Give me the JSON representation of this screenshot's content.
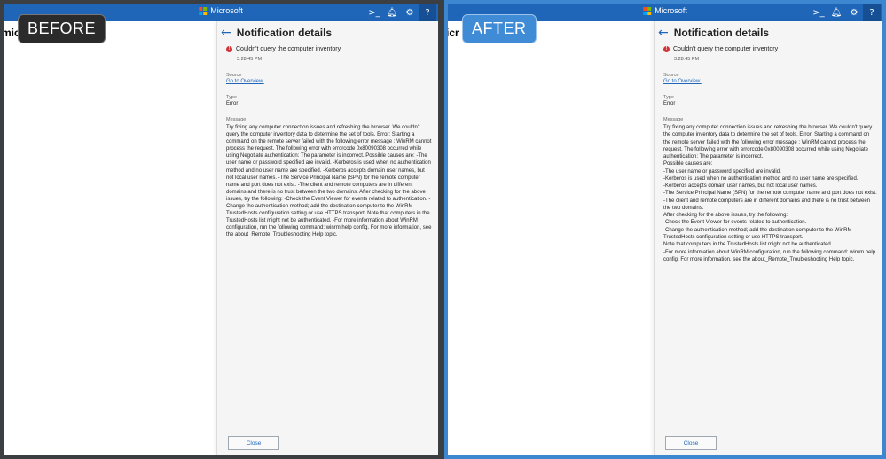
{
  "before": {
    "badge": "BEFORE",
    "background_text": "mic",
    "topbar": {
      "brand": "Microsoft",
      "icons": [
        "terminal-icon",
        "bell-icon",
        "gear-icon",
        "help-icon"
      ]
    },
    "pane": {
      "title": "Notification details",
      "error_title": "Couldn't query the computer inventory",
      "time": "3:28:45 PM",
      "source_label": "Source",
      "source_link": "Go to Overview.",
      "type_label": "Type",
      "type_value": "Error",
      "message_label": "Message",
      "message": "Try fixing any computer connection issues and refreshing the browser. We couldn't query the computer inventory data to determine the set of tools. Error: Starting a command on the remote server failed with the following error message : WinRM cannot process the request. The following error with errorcode 0x80090308 occurred while using Negotiate authentication: The parameter is incorrect. Possible causes are: -The user name or password specified are invalid. -Kerberos is used when no authentication method and no user name are specified. -Kerberos accepts domain user names, but not local user names. -The Service Principal Name (SPN) for the remote computer name and port does not exist. -The client and remote computers are in different domains and there is no trust between the two domains. After checking for the above issues, try the following: -Check the Event Viewer for events related to authentication. -Change the authentication method; add the destination computer to the WinRM TrustedHosts configuration setting or use HTTPS transport. Note that computers in the TrustedHosts list might not be authenticated. -For more information about WinRM configuration, run the following command: winrm help config. For more information, see the about_Remote_Troubleshooting Help topic.",
      "close_label": "Close"
    }
  },
  "after": {
    "badge": "AFTER",
    "background_text": "icr",
    "topbar": {
      "brand": "Microsoft",
      "icons": [
        "terminal-icon",
        "bell-icon",
        "gear-icon",
        "help-icon"
      ]
    },
    "pane": {
      "title": "Notification details",
      "error_title": "Couldn't query the computer inventory",
      "time": "3:28:45 PM",
      "source_label": "Source",
      "source_link": "Go to Overview.",
      "type_label": "Type",
      "type_value": "Error",
      "message_label": "Message",
      "message": " Try fixing any computer connection issues and refreshing the browser. We couldn't query the computer inventory data to determine the set of tools. Error: Starting a command on the remote server failed with the following error message : WinRM cannot process the request. The following error with errorcode 0x80090308 occurred while using Negotiate authentication: The parameter is incorrect.\n Possible causes are:\n   -The user name or password specified are invalid.\n   -Kerberos is used when no authentication method and no user name are specified.\n   -Kerberos accepts domain user names, but not local user names.\n   -The Service Principal Name (SPN) for the remote computer name and port does not exist.\n   -The client and remote computers are in different domains and there is no trust between the two domains.\n After checking for the above issues, try the following:\n   -Check the Event Viewer for events related to authentication.\n   -Change the authentication method; add the destination computer to the WinRM TrustedHosts configuration setting or use HTTPS transport.\n Note that computers in the TrustedHosts list might not be authenticated.\n   -For more information about WinRM configuration, run the following command: winrm help config. For more information, see the about_Remote_Troubleshooting Help topic.",
      "close_label": "Close"
    }
  }
}
